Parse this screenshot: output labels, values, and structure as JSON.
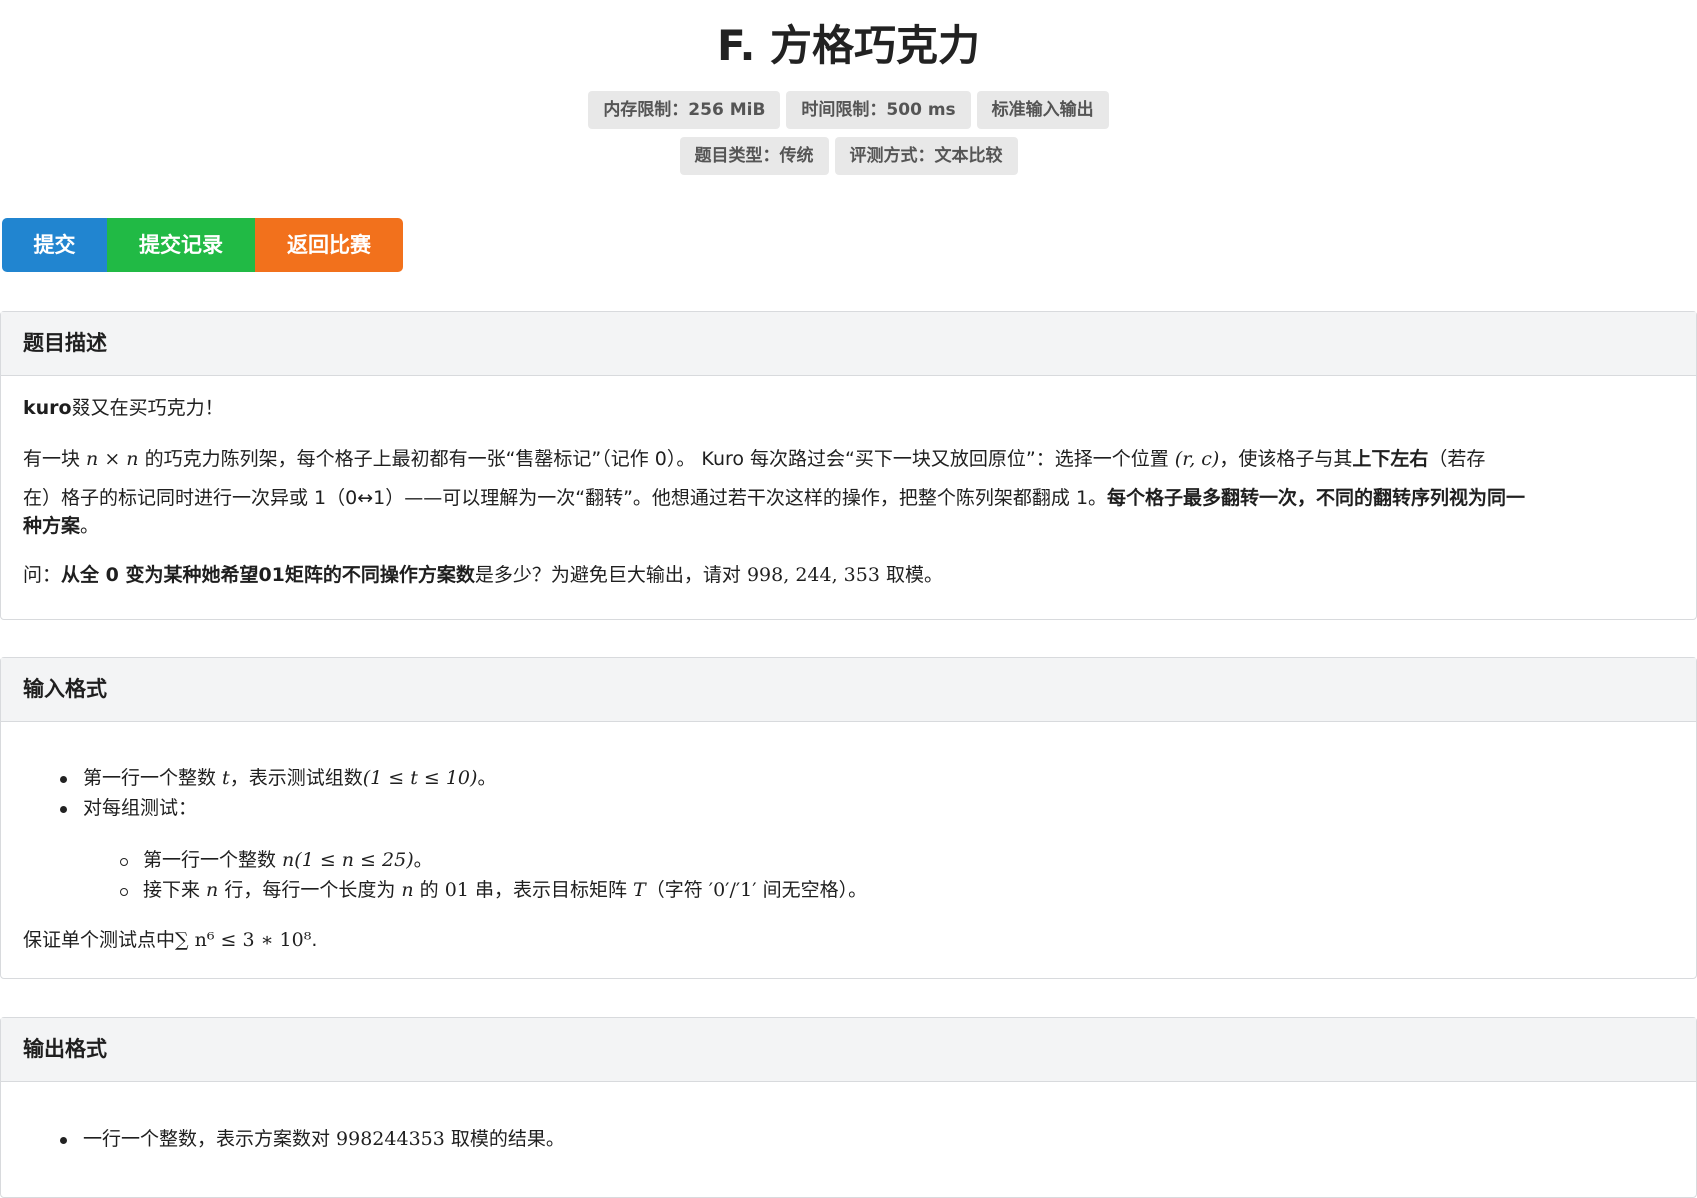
{
  "title": "F. 方格巧克力",
  "badges_row1": [
    "内存限制：256 MiB",
    "时间限制：500 ms",
    "标准输入输出"
  ],
  "badges_row2": [
    "题目类型：传统",
    "评测方式：文本比较"
  ],
  "buttons": {
    "submit": "提交",
    "records": "提交记录",
    "back": "返回比赛"
  },
  "description": {
    "heading": "题目描述",
    "p1_bold": "kuro",
    "p1_rest": "叕又在买巧克力！",
    "p2_l1_a": "有一块 ",
    "p2_l1_m1": "n × n",
    "p2_l1_b": " 的巧克力陈列架，每个格子上最初都有一张“售罄标记”（记作 0）。 Kuro 每次路过会“买下一块又放回原位”：选择一个位置 ",
    "p2_l1_m2": "(r, c)",
    "p2_l1_c": "，使该格子与其",
    "p2_l1_bold": "上下左右",
    "p2_l1_d": "（若存",
    "p2_l2_a": "在）格子的标记同时进行一次异或 1（0↔1）——可以理解为一次“翻转”。他想通过若干次这样的操作，把整个陈列架都翻成 1。",
    "p2_l2_bold": "每个格子最多翻转一次，不同的翻转序列视为同一",
    "p2_l3_bold": "种方案",
    "p2_l3_rest": "。",
    "p3_a": "问：",
    "p3_bold": "从全 0 变为某种她希望01矩阵的不同操作方案数",
    "p3_b": "是多少？为避免巨大输出，请对 ",
    "p3_m": "998, 244, 353",
    "p3_c": " 取模。"
  },
  "input": {
    "heading": "输入格式",
    "i1_a": "第一行一个整数 ",
    "i1_m1": "t",
    "i1_b": "，表示测试组数",
    "i1_m2": "(1 ≤ t ≤ 10)",
    "i1_c": "。",
    "i2": "对每组测试：",
    "s1_a": "第一行一个整数 ",
    "s1_m": "n(1 ≤ n ≤ 25)",
    "s1_b": "。",
    "s2_a": "接下来 ",
    "s2_m1": "n",
    "s2_b": " 行，每行一个长度为 ",
    "s2_m2": "n",
    "s2_c": " 的 ",
    "s2_m3": "01",
    "s2_d": " 串，表示目标矩阵 ",
    "s2_m4": "T",
    "s2_e": "（字符 ",
    "s2_m5": "′0′/′1′",
    "s2_f": " 间无空格）。",
    "g_a": "保证单个测试点中",
    "g_m": "∑ n⁶ ≤ 3 ∗ 10⁸",
    "g_b": "."
  },
  "output": {
    "heading": "输出格式",
    "o1_a": "一行一个整数，表示方案数对 ",
    "o1_m": "998244353",
    "o1_b": " 取模的结果。"
  }
}
